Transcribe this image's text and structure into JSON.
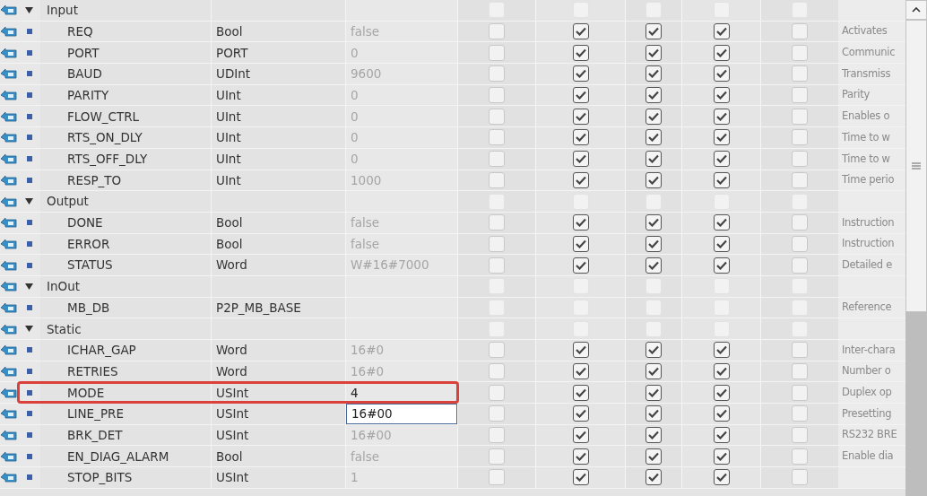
{
  "sections": [
    {
      "name": "Input",
      "expanded": true,
      "checks": [
        false,
        false,
        false,
        false,
        false
      ],
      "children": [
        {
          "name": "REQ",
          "type": "Bool",
          "value": "false",
          "checks": [
            false,
            true,
            true,
            true,
            false
          ],
          "comment": "Activates",
          "highlighted": false,
          "editing": false
        },
        {
          "name": "PORT",
          "type": "PORT",
          "value": "0",
          "checks": [
            false,
            true,
            true,
            true,
            false
          ],
          "comment": "Communic",
          "highlighted": false,
          "editing": false
        },
        {
          "name": "BAUD",
          "type": "UDInt",
          "value": "9600",
          "checks": [
            false,
            true,
            true,
            true,
            false
          ],
          "comment": "Transmiss",
          "highlighted": false,
          "editing": false
        },
        {
          "name": "PARITY",
          "type": "UInt",
          "value": "0",
          "checks": [
            false,
            true,
            true,
            true,
            false
          ],
          "comment": "Parity",
          "highlighted": false,
          "editing": false
        },
        {
          "name": "FLOW_CTRL",
          "type": "UInt",
          "value": "0",
          "checks": [
            false,
            true,
            true,
            true,
            false
          ],
          "comment": "Enables o",
          "highlighted": false,
          "editing": false
        },
        {
          "name": "RTS_ON_DLY",
          "type": "UInt",
          "value": "0",
          "checks": [
            false,
            true,
            true,
            true,
            false
          ],
          "comment": "Time to w",
          "highlighted": false,
          "editing": false
        },
        {
          "name": "RTS_OFF_DLY",
          "type": "UInt",
          "value": "0",
          "checks": [
            false,
            true,
            true,
            true,
            false
          ],
          "comment": "Time to w",
          "highlighted": false,
          "editing": false
        },
        {
          "name": "RESP_TO",
          "type": "UInt",
          "value": "1000",
          "checks": [
            false,
            true,
            true,
            true,
            false
          ],
          "comment": "Time perio",
          "highlighted": false,
          "editing": false
        }
      ]
    },
    {
      "name": "Output",
      "expanded": true,
      "checks": [
        false,
        false,
        false,
        false,
        false
      ],
      "children": [
        {
          "name": "DONE",
          "type": "Bool",
          "value": "false",
          "checks": [
            false,
            true,
            true,
            true,
            false
          ],
          "comment": "Instruction",
          "highlighted": false,
          "editing": false
        },
        {
          "name": "ERROR",
          "type": "Bool",
          "value": "false",
          "checks": [
            false,
            true,
            true,
            true,
            false
          ],
          "comment": "Instruction",
          "highlighted": false,
          "editing": false
        },
        {
          "name": "STATUS",
          "type": "Word",
          "value": "W#16#7000",
          "checks": [
            false,
            true,
            true,
            true,
            false
          ],
          "comment": "Detailed e",
          "highlighted": false,
          "editing": false
        }
      ]
    },
    {
      "name": "InOut",
      "expanded": true,
      "checks": [
        false,
        false,
        false,
        false,
        false
      ],
      "children": [
        {
          "name": "MB_DB",
          "type": "P2P_MB_BASE",
          "checks": [
            false,
            false,
            false,
            false,
            false
          ],
          "comment": "Reference",
          "highlighted": false,
          "editing": false
        }
      ]
    },
    {
      "name": "Static",
      "expanded": true,
      "checks": [
        false,
        false,
        false,
        false,
        false
      ],
      "children": [
        {
          "name": "ICHAR_GAP",
          "type": "Word",
          "value": "16#0",
          "checks": [
            false,
            true,
            true,
            true,
            false
          ],
          "comment": "Inter-chara",
          "highlighted": false,
          "editing": false
        },
        {
          "name": "RETRIES",
          "type": "Word",
          "value": "16#0",
          "checks": [
            false,
            true,
            true,
            true,
            false
          ],
          "comment": "Number o",
          "highlighted": false,
          "editing": false
        },
        {
          "name": "MODE",
          "type": "USInt",
          "value": "4",
          "checks": [
            false,
            true,
            true,
            true,
            false
          ],
          "comment": "Duplex op",
          "highlighted": true,
          "editing": false
        },
        {
          "name": "LINE_PRE",
          "type": "USInt",
          "value": "16#00",
          "checks": [
            false,
            true,
            true,
            true,
            false
          ],
          "comment": "Presetting",
          "highlighted": false,
          "editing": true
        },
        {
          "name": "BRK_DET",
          "type": "USInt",
          "value": "16#00",
          "checks": [
            false,
            true,
            true,
            true,
            false
          ],
          "comment": "RS232 BRE",
          "highlighted": false,
          "editing": false
        },
        {
          "name": "EN_DIAG_ALARM",
          "type": "Bool",
          "value": "false",
          "checks": [
            false,
            true,
            true,
            true,
            false
          ],
          "comment": "Enable dia",
          "highlighted": false,
          "editing": false
        },
        {
          "name": "STOP_BITS",
          "type": "USInt",
          "value": "1",
          "checks": [
            false,
            true,
            true,
            true,
            false
          ],
          "highlighted": false,
          "editing": false
        }
      ]
    }
  ]
}
